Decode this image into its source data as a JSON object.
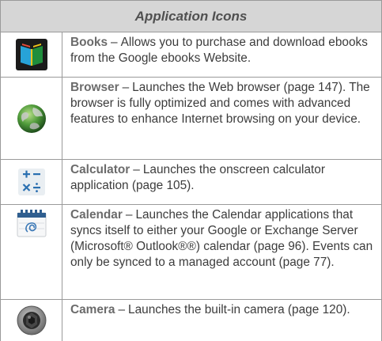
{
  "table": {
    "title": "Application Icons",
    "rows": [
      {
        "name": "Books",
        "icon": "books-icon",
        "dash": "–",
        "desc": "Allows you to purchase and download ebooks from the Google ebooks Website."
      },
      {
        "name": "Browser",
        "icon": "browser-globe-icon",
        "dash": "–",
        "desc": "Launches the Web browser (page 147). The browser is fully optimized and comes with advanced features to enhance Internet browsing on your device."
      },
      {
        "name": "Calculator",
        "icon": "calculator-icon",
        "dash": "–",
        "desc": "Launches the onscreen calculator application (page 105)."
      },
      {
        "name": "Calendar",
        "icon": "calendar-icon",
        "dash": "–",
        "desc": "Launches the Calendar applications that syncs itself to either your Google or Exchange Server (Microsoft® Outlook®®) calendar (page 96). Events can only be synced to a managed account (page 77)."
      },
      {
        "name": "Camera",
        "icon": "camera-icon",
        "dash": "–",
        "desc": "Launches the built-in camera (page 120)."
      }
    ]
  }
}
